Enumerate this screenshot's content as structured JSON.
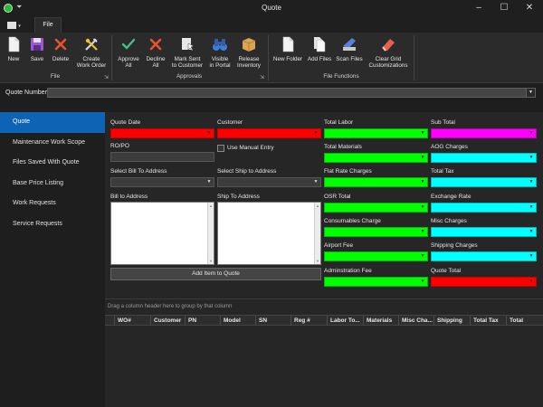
{
  "window": {
    "title": "Quote"
  },
  "ribbon": {
    "tab_file": "File",
    "groups": {
      "file": "File",
      "approvals": "Approvals",
      "file_functions": "File Functions"
    },
    "buttons": {
      "new": "New",
      "save": "Save",
      "delete": "Delete",
      "create_work_order_l1": "Create",
      "create_work_order_l2": "Work Order",
      "approve_all_l1": "Approve",
      "approve_all_l2": "All",
      "decline_all_l1": "Decline",
      "decline_all_l2": "All",
      "mark_sent_l1": "Mark Sent",
      "mark_sent_l2": "to Customer",
      "visible_portal_l1": "Visible",
      "visible_portal_l2": "in Portal",
      "release_inventory_l1": "Release",
      "release_inventory_l2": "Inventory",
      "new_folder": "New Folder",
      "add_files": "Add Files",
      "scan_files": "Scan Files",
      "clear_grid_l1": "Clear Grid",
      "clear_grid_l2": "Customizations"
    }
  },
  "quote_number": {
    "label": "Quote Number"
  },
  "nav": {
    "items": [
      "Quote",
      "Maintenance Work Scope",
      "Files Saved With Quote",
      "Base Price Listing",
      "Work Requests",
      "Service Requests"
    ]
  },
  "form": {
    "quote_date": "Quote Date",
    "customer": "Customer",
    "ro_po": "RO/PO",
    "use_manual_entry": "Use Manual Entry",
    "select_bill_to": "Select Bill To Address",
    "select_ship_to": "Select Ship to Address",
    "bill_to_address": "Bill to Address",
    "ship_to_address": "Ship To Address",
    "add_item_button": "Add Item to Quote",
    "total_labor": "Total Labor",
    "total_materials": "Total Materials",
    "flat_rate_charges": "Flat Rate Charges",
    "osr_total": "OSR Total",
    "consumables_charge": "Consumables Charge",
    "airport_fee": "Airport Fee",
    "administration_fee": "Adminstration Fee",
    "sub_total": "Sub Total",
    "aog_charges": "AOG Charges",
    "total_tax": "Total Tax",
    "exchange_rate": "Exchange Rate",
    "misc_charges": "Misc Charges",
    "shipping_charges": "Shipping Charges",
    "quote_total": "Quote Total"
  },
  "grid": {
    "group_hint": "Drag a column header here to group by that column",
    "columns": [
      "WO#",
      "Customer",
      "PN",
      "Model",
      "SN",
      "Reg #",
      "Labor To...",
      "Materials",
      "Misc Cha...",
      "Shipping",
      "Total Tax",
      "Total"
    ]
  },
  "colors": {
    "accent": "#0e63b5",
    "red_field": "#ff0000",
    "green_field": "#00ff00",
    "cyan_field": "#00ffff",
    "magenta_field": "#ff00ff"
  }
}
